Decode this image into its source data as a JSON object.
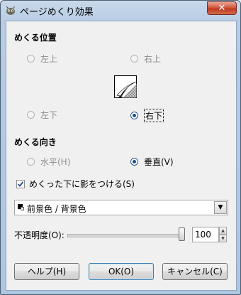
{
  "window": {
    "title": "ページめくり効果",
    "close_label": "✕"
  },
  "curl_location": {
    "title": "めくる位置",
    "top_left": "左上",
    "top_right": "右上",
    "bottom_left": "左下",
    "bottom_right": "右下",
    "selected": "右下"
  },
  "curl_orientation": {
    "title": "めくる向き",
    "horizontal": "水平(H)",
    "vertical": "垂直(V)",
    "selected": "垂直(V)"
  },
  "shade_checkbox": {
    "label": "めくった下に影をつける(S)",
    "checked": true
  },
  "gradient_combo": {
    "value": "前景色 / 背景色",
    "dropdown_icon": "triangle-down"
  },
  "opacity": {
    "label": "不透明度(O):",
    "value": "100",
    "level_percent": 100
  },
  "buttons": {
    "help": "ヘルプ(H)",
    "ok": "OK(O)",
    "cancel": "キャンセル(C)"
  },
  "colors": {
    "title_bar": "#b7cce3",
    "close_button": "#c0381e",
    "client_bg": "#f0f0f0"
  }
}
